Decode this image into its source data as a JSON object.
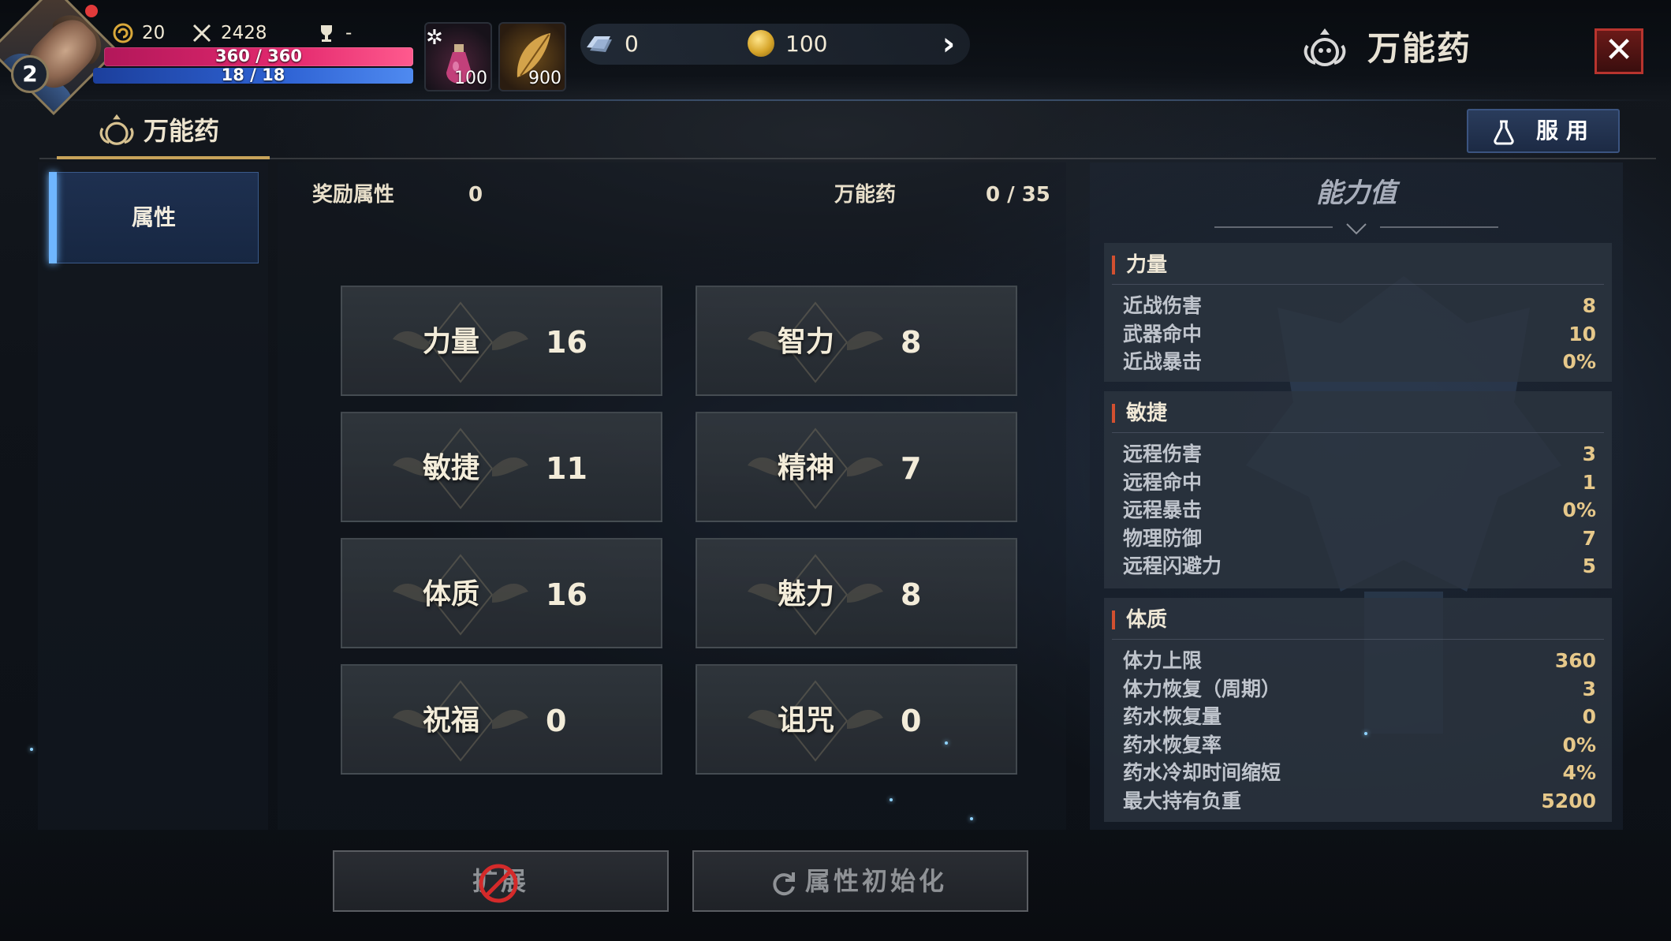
{
  "hud": {
    "level": "2",
    "currency_a": "20",
    "combat_power": "2428",
    "trophy": "-",
    "hp_text": "360 / 360",
    "mp_text": "18 / 18",
    "hp_fill": 1.0,
    "mp_fill": 1.0,
    "slot1_count": "100",
    "slot2_count": "900",
    "gems": "0",
    "gold": "100"
  },
  "window": {
    "title": "万能药",
    "close_glyph": "✕"
  },
  "subheader": {
    "tab_label": "万能药",
    "use_button": "服用"
  },
  "sidebar": {
    "items": [
      {
        "label": "属性"
      }
    ]
  },
  "info": {
    "bonus_label": "奖励属性",
    "bonus_value": "0",
    "elixir_label": "万能药",
    "elixir_value": "0 / 35"
  },
  "stats": [
    {
      "name": "力量",
      "value": "16"
    },
    {
      "name": "智力",
      "value": "8"
    },
    {
      "name": "敏捷",
      "value": "11"
    },
    {
      "name": "精神",
      "value": "7"
    },
    {
      "name": "体质",
      "value": "16"
    },
    {
      "name": "魅力",
      "value": "8"
    },
    {
      "name": "祝福",
      "value": "0"
    },
    {
      "name": "诅咒",
      "value": "0"
    }
  ],
  "buttons": {
    "expand": "扩展",
    "reset": "属性初始化"
  },
  "ability": {
    "title": "能力值",
    "sections": [
      {
        "name": "力量",
        "rows": [
          {
            "label": "近战伤害",
            "value": "8"
          },
          {
            "label": "武器命中",
            "value": "10"
          },
          {
            "label": "近战暴击",
            "value": "0%"
          }
        ]
      },
      {
        "name": "敏捷",
        "rows": [
          {
            "label": "远程伤害",
            "value": "3"
          },
          {
            "label": "远程命中",
            "value": "1"
          },
          {
            "label": "远程暴击",
            "value": "0%"
          },
          {
            "label": "物理防御",
            "value": "7"
          },
          {
            "label": "远程闪避力",
            "value": "5"
          }
        ]
      },
      {
        "name": "体质",
        "rows": [
          {
            "label": "体力上限",
            "value": "360"
          },
          {
            "label": "体力恢复（周期）",
            "value": "3"
          },
          {
            "label": "药水恢复量",
            "value": "0"
          },
          {
            "label": "药水恢复率",
            "value": "0%"
          },
          {
            "label": "药水冷却时间缩短",
            "value": "4%"
          },
          {
            "label": "最大持有负重",
            "value": "5200"
          }
        ]
      }
    ]
  },
  "colors": {
    "hp": "#e3296e",
    "mp": "#2f63d4",
    "accent_gold": "#c7a35a",
    "close_red": "#b8342e",
    "sidebar_accent": "#6fb6ff"
  },
  "icons": {
    "currency_a": "swirl-coin-icon",
    "combat_power": "crossed-swords-icon",
    "trophy": "trophy-icon",
    "settings": "gear-icon",
    "potion": "potion-icon",
    "leaf": "feather-icon",
    "gem": "gem-icon",
    "gold": "gold-coin-icon",
    "arrow": "chevron-right-icon",
    "title": "elixir-emblem-icon",
    "reset": "refresh-icon",
    "forbid": "forbidden-icon"
  }
}
